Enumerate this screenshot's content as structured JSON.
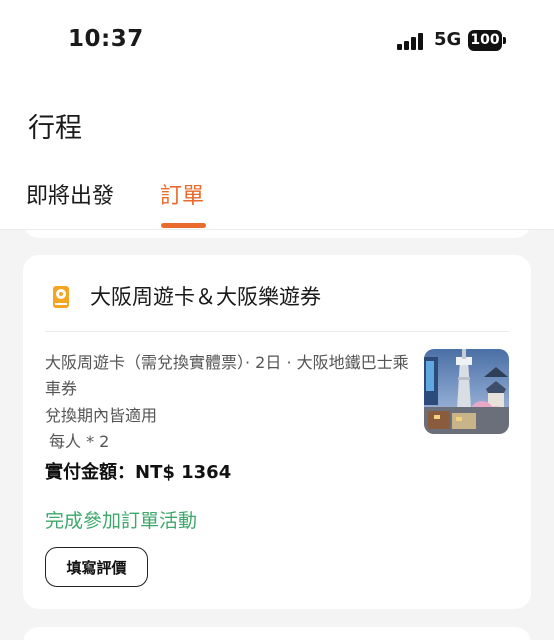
{
  "status_bar": {
    "time": "10:37",
    "network": "5G",
    "battery": "100"
  },
  "page": {
    "title": "行程"
  },
  "tabs": [
    {
      "label": "即將出發",
      "active": false
    },
    {
      "label": "訂單",
      "active": true
    }
  ],
  "order": {
    "product_title": "大阪周遊卡＆大阪樂遊券",
    "product_icon": "pass-ticket-icon",
    "description": "大阪周遊卡（需兌換實體票）· 2日 · 大阪地鐵巴士乘車券",
    "validity": "兌換期內皆適用",
    "persons": "每人 * 2",
    "price": "實付金額：NT$ 1364",
    "activity_link": "完成參加訂單活動",
    "review_button": "填寫評價"
  },
  "colors": {
    "accent": "#ea6a2e",
    "success": "#3ea86b",
    "background": "#f4f4f4"
  }
}
